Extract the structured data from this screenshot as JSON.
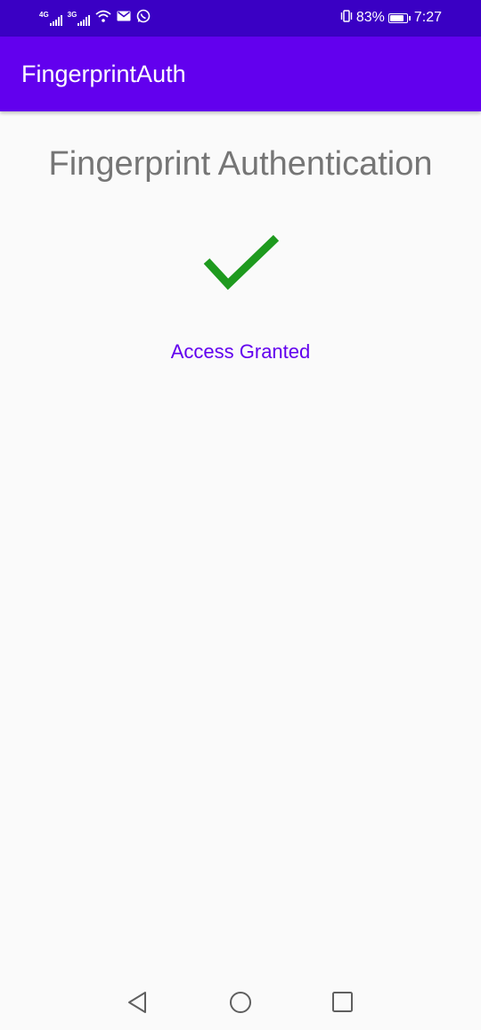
{
  "status_bar": {
    "background": "#3a00c4",
    "network_1": "4G",
    "network_2": "3G",
    "battery_percent": "83%",
    "battery_level": 0.83,
    "time": "7:27",
    "icons": [
      "signal-icon",
      "signal-icon",
      "wifi-icon",
      "mail-icon",
      "whatsapp-icon",
      "vibrate-icon",
      "battery-icon"
    ]
  },
  "app_bar": {
    "title": "FingerprintAuth",
    "background": "#6200ee"
  },
  "main": {
    "heading": "Fingerprint Authentication",
    "status_icon": "checkmark-icon",
    "status_icon_color": "#1e9a1e",
    "status_text": "Access Granted",
    "status_text_color": "#6200ee"
  },
  "nav_bar": {
    "items": [
      {
        "name": "back-icon"
      },
      {
        "name": "home-icon"
      },
      {
        "name": "recents-icon"
      }
    ]
  }
}
